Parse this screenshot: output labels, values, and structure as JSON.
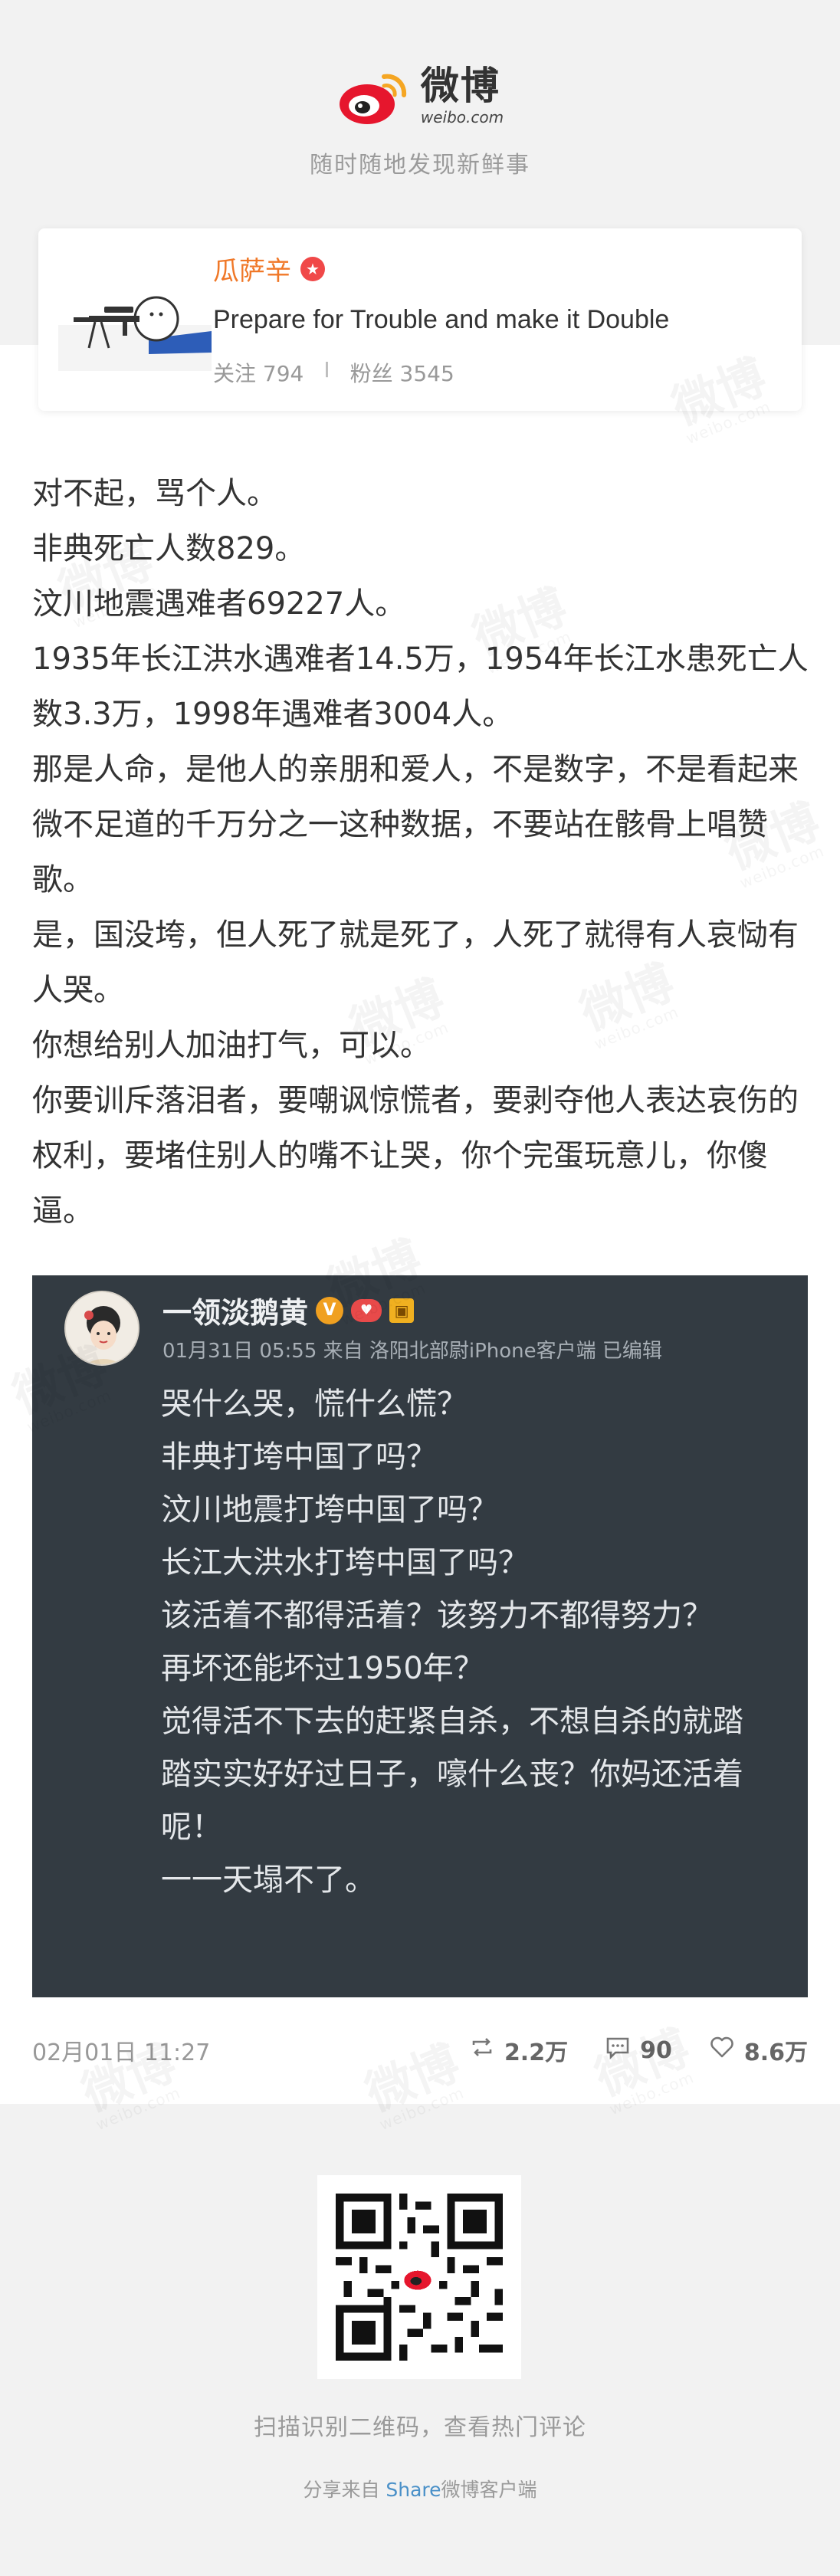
{
  "header": {
    "logo_cn": "微博",
    "logo_url": "weibo.com",
    "slogan": "随时随地发现新鲜事"
  },
  "profile": {
    "name": "瓜萨辛",
    "bio": "Prepare for Trouble and make it Double",
    "follow_label": "关注 794",
    "separator": "I",
    "fans_label": "粉丝 3545"
  },
  "post": {
    "paragraphs": [
      "对不起，骂个人。",
      "非典死亡人数829。",
      "汶川地震遇难者69227人。",
      "1935年长江洪水遇难者14.5万，1954年长江水患死亡人数3.3万，1998年遇难者3004人。",
      "那是人命，是他人的亲朋和爱人，不是数字，不是看起来微不足道的千万分之一这种数据，不要站在骸骨上唱赞歌。",
      "是，国没垮，但人死了就是死了，人死了就得有人哀恸有人哭。",
      "你想给别人加油打气，可以。",
      "你要训斥落泪者，要嘲讽惊慌者，要剥夺他人表达哀伤的权利，要堵住别人的嘴不让哭，你个完蛋玩意儿，你傻逼。"
    ]
  },
  "quoted": {
    "name": "一领淡鹅黄",
    "meta": "01月31日 05:55 来自 洛阳北部尉iPhone客户端  已编辑",
    "lines": [
      "哭什么哭，慌什么慌？",
      "非典打垮中国了吗？",
      "汶川地震打垮中国了吗？",
      "长江大洪水打垮中国了吗？",
      "该活着不都得活着？该努力不都得努力？",
      "再坏还能坏过1950年？",
      "觉得活不下去的赶紧自杀，不想自杀的就踏踏实实好好过日子，嚎什么丧？你妈还活着呢！",
      "一一天塌不了。"
    ]
  },
  "footer": {
    "date": "02月01日 11:27",
    "repost_count": "2.2万",
    "comment_count": "90",
    "like_count": "8.6万"
  },
  "bottom": {
    "qr_tip": "扫描识别二维码，查看热门评论",
    "share_prefix": "分享来自 ",
    "share_app": "Share",
    "share_suffix": "微博客户端"
  },
  "colors": {
    "brand_orange": "#f07828",
    "weibo_red": "#e6162d",
    "screenshot_bg": "#333b42"
  }
}
